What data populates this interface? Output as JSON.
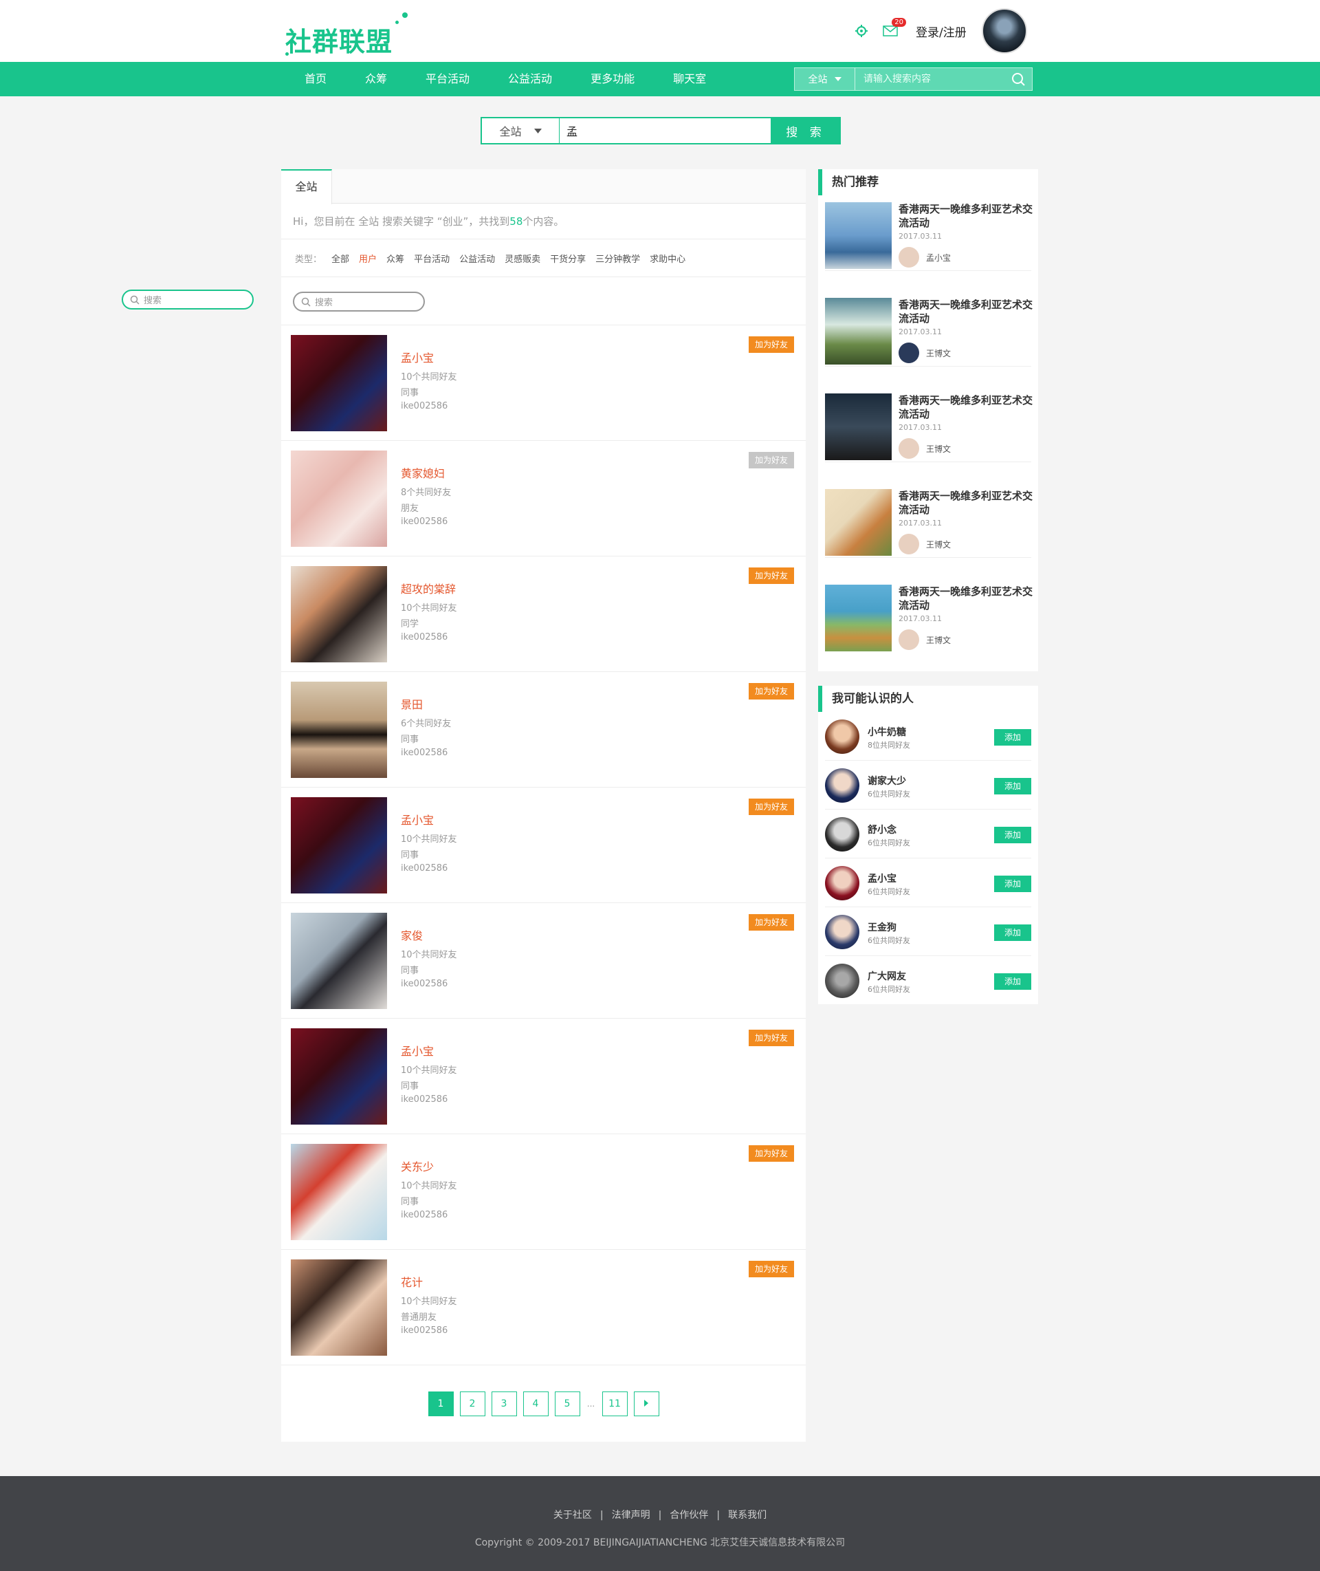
{
  "header": {
    "logo_text": "社群联盟",
    "mail_count": "20",
    "login_label": "登录/注册"
  },
  "nav": {
    "items": [
      "首页",
      "众筹",
      "平台活动",
      "公益活动",
      "更多功能",
      "聊天室"
    ],
    "search_scope": "全站",
    "search_placeholder": "请输入搜索内容"
  },
  "main_search": {
    "scope": "全站",
    "value": "孟",
    "button_label": "搜 索"
  },
  "left_search": {
    "placeholder": "搜索"
  },
  "results": {
    "tab": "全站",
    "hi_prefix": "Hi，您目前在 全站 搜索关键字 “创业”，共找到",
    "hi_count": "58",
    "hi_suffix": "个内容。",
    "types_label": "类型：",
    "types": [
      "全部",
      "用户",
      "众筹",
      "平台活动",
      "公益活动",
      "灵感贩卖",
      "干货分享",
      "三分钟教学",
      "求助中心"
    ],
    "active_type": "用户",
    "filter_placeholder": "搜索",
    "items": [
      {
        "name": "孟小宝",
        "mutual": "10个共同好友",
        "relation": "同事",
        "id": "ike002586",
        "btn": "加为好友",
        "btn_disabled": false
      },
      {
        "name": "黄家媳妇",
        "mutual": "8个共同好友",
        "relation": "朋友",
        "id": "ike002586",
        "btn": "加为好友",
        "btn_disabled": true
      },
      {
        "name": "超攻的棠辞",
        "mutual": "10个共同好友",
        "relation": "同学",
        "id": "ike002586",
        "btn": "加为好友",
        "btn_disabled": false
      },
      {
        "name": "景田",
        "mutual": "6个共同好友",
        "relation": "同事",
        "id": "ike002586",
        "btn": "加为好友",
        "btn_disabled": false
      },
      {
        "name": "孟小宝",
        "mutual": "10个共同好友",
        "relation": "同事",
        "id": "ike002586",
        "btn": "加为好友",
        "btn_disabled": false
      },
      {
        "name": "家俊",
        "mutual": "10个共同好友",
        "relation": "同事",
        "id": "ike002586",
        "btn": "加为好友",
        "btn_disabled": false
      },
      {
        "name": "孟小宝",
        "mutual": "10个共同好友",
        "relation": "同事",
        "id": "ike002586",
        "btn": "加为好友",
        "btn_disabled": false
      },
      {
        "name": "关东少",
        "mutual": "10个共同好友",
        "relation": "同事",
        "id": "ike002586",
        "btn": "加为好友",
        "btn_disabled": false
      },
      {
        "name": "花计",
        "mutual": "10个共同好友",
        "relation": "普通朋友",
        "id": "ike002586",
        "btn": "加为好友",
        "btn_disabled": false
      }
    ],
    "pagination": [
      "1",
      "2",
      "3",
      "4",
      "5",
      "...",
      "11"
    ],
    "current_page": "1"
  },
  "hot": {
    "title": "热门推荐",
    "items": [
      {
        "title": "香港两天一晚维多利亚艺术交流活动",
        "date": "2017.03.11",
        "author": "孟小宝"
      },
      {
        "title": "香港两天一晚维多利亚艺术交流活动",
        "date": "2017.03.11",
        "author": "王博文"
      },
      {
        "title": "香港两天一晚维多利亚艺术交流活动",
        "date": "2017.03.11",
        "author": "王博文"
      },
      {
        "title": "香港两天一晚维多利亚艺术交流活动",
        "date": "2017.03.11",
        "author": "王博文"
      },
      {
        "title": "香港两天一晚维多利亚艺术交流活动",
        "date": "2017.03.11",
        "author": "王博文"
      }
    ]
  },
  "people": {
    "title": "我可能认识的人",
    "items": [
      {
        "name": "小牛奶糖",
        "mutual": "8位共同好友",
        "btn": "添加"
      },
      {
        "name": "谢家大少",
        "mutual": "6位共同好友",
        "btn": "添加"
      },
      {
        "name": "舒小念",
        "mutual": "6位共同好友",
        "btn": "添加"
      },
      {
        "name": "孟小宝",
        "mutual": "6位共同好友",
        "btn": "添加"
      },
      {
        "name": "王金狗",
        "mutual": "6位共同好友",
        "btn": "添加"
      },
      {
        "name": "广大网友",
        "mutual": "6位共同好友",
        "btn": "添加"
      }
    ]
  },
  "footer": {
    "links": [
      "关于社区",
      "法律声明",
      "合作伙伴",
      "联系我们"
    ],
    "copyright": "Copyright © 2009-2017 BEIJINGAIJIATIANCHENG 北京艾佳天诚信息技术有限公司"
  },
  "colors": {
    "brand": "#19c48c",
    "accent_orange": "#f28b1f",
    "name_red": "#e4572e",
    "footer_bg": "#424448"
  }
}
